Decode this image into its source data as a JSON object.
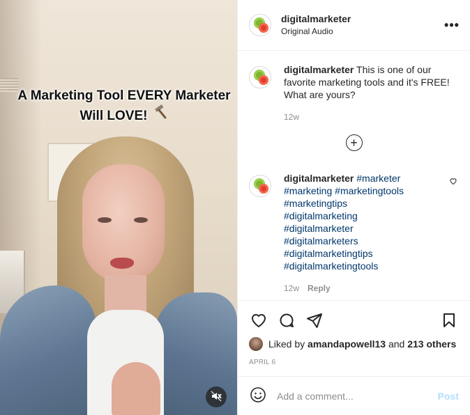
{
  "video": {
    "caption_line1": "A Marketing Tool EVERY Marketer",
    "caption_line2": "Will LOVE!",
    "caption_emoji": "hammer-icon",
    "mute_icon": "speaker-muted-icon"
  },
  "header": {
    "username": "digitalmarketer",
    "audio": "Original Audio",
    "more_icon": "ellipsis-icon",
    "more_label": "•••"
  },
  "comments": [
    {
      "username": "digitalmarketer",
      "text": "This is one of our favorite marketing tools and it's FREE! What are yours?",
      "time": "12w"
    },
    {
      "username": "digitalmarketer",
      "hashtags": [
        "#marketer",
        "#marketing",
        "#marketingtools",
        "#marketingtips",
        "#digitalmarketing",
        "#digitalmarketer",
        "#digitalmarketers",
        "#digitalmarketingtips",
        "#digitalmarketingtools"
      ],
      "time": "12w",
      "reply_label": "Reply"
    }
  ],
  "load_more_label": "+",
  "actions": {
    "like_icon": "heart-icon",
    "comment_icon": "comment-bubble-icon",
    "share_icon": "paper-plane-icon",
    "save_icon": "bookmark-icon"
  },
  "likes": {
    "prefix": "Liked by",
    "user": "amandapowell13",
    "middle": "and",
    "others": "213 others"
  },
  "date": "APRIL 6",
  "add_comment": {
    "placeholder": "Add a comment...",
    "post_label": "Post",
    "emoji_icon": "smiley-icon"
  },
  "colors": {
    "hashtag": "#00376b",
    "muted_text": "#8e8e8e",
    "post_button": "#b2dffc",
    "text": "#262626"
  }
}
